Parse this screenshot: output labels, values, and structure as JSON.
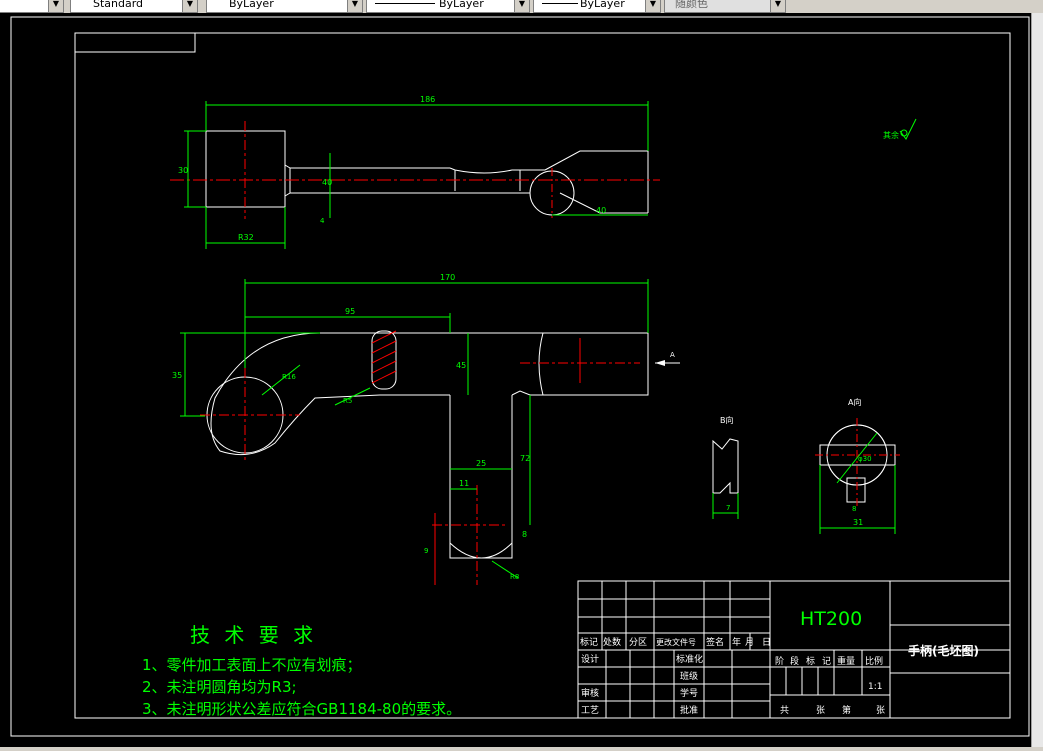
{
  "toolbar": {
    "text_style": "Standard",
    "layer": "ByLayer",
    "linetype": "ByLayer",
    "lineweight": "ByLayer",
    "plot_style": "随颜色"
  },
  "drawing": {
    "dimensions": {
      "top_length": "186",
      "top_height": "30",
      "top_diam": "40",
      "top_small": "4",
      "top_right": "40",
      "top_bottom": "R32",
      "front_total": "170",
      "front_95": "95",
      "front_35": "35",
      "front_45": "45",
      "front_r16": "R16",
      "front_r5": "R5",
      "front_25": "25",
      "front_11": "11",
      "front_72": "72",
      "front_8": "8",
      "front_9": "9",
      "front_r8": "R8",
      "view_b_7": "7",
      "view_a_31": "31",
      "view_a_phi": "φ30",
      "view_a_8": "8"
    },
    "labels": {
      "view_b": "B向",
      "view_a": "A向",
      "arrow_a": "A",
      "roughness": "其余"
    }
  },
  "notes": {
    "title": "技 术 要 求",
    "lines": [
      "1、零件加工表面上不应有划痕；",
      "2、未注明圆角均为R3;",
      "3、未注明形状公差应符合GB1184-80的要求。"
    ]
  },
  "title_block": {
    "material": "HT200",
    "part_name": "手柄(毛坯图)",
    "header_row": [
      "标记",
      "处数",
      "分区",
      "更改文件号",
      "签名",
      "年",
      "月",
      "日"
    ],
    "design": "设计",
    "standardize": "标准化",
    "class": "班级",
    "student_no": "学号",
    "review": "审核",
    "process": "工艺",
    "approve": "批准",
    "stage": "阶",
    "stage2": "段",
    "mark": "标",
    "mark2": "记",
    "weight": "重量",
    "scale_label": "比例",
    "scale": "1:1",
    "total": "共",
    "sheets": "张",
    "page": "第",
    "sheets2": "张"
  }
}
